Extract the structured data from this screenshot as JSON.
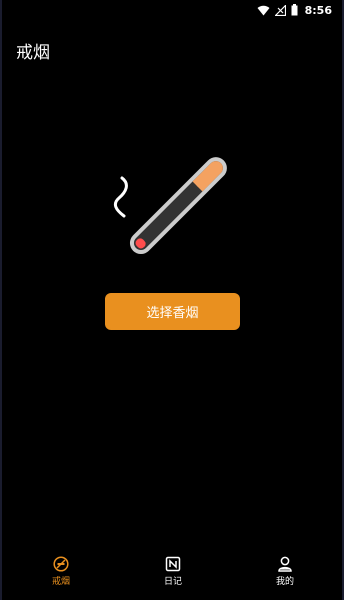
{
  "status_bar": {
    "time": "8:56"
  },
  "app_bar": {
    "title": "戒烟"
  },
  "main": {
    "select_button_label": "选择香烟"
  },
  "bottom_nav": {
    "items": [
      {
        "label": "戒烟",
        "icon": "no-smoking-icon",
        "active": true
      },
      {
        "label": "日记",
        "icon": "diary-icon",
        "active": false
      },
      {
        "label": "我的",
        "icon": "profile-icon",
        "active": false
      }
    ]
  },
  "colors": {
    "accent": "#e9901f",
    "background": "#000000",
    "cigarette_body": "#333333",
    "cigarette_outline": "#cccccc",
    "filter": "#f4a261",
    "ember": "#ff4d4d"
  }
}
